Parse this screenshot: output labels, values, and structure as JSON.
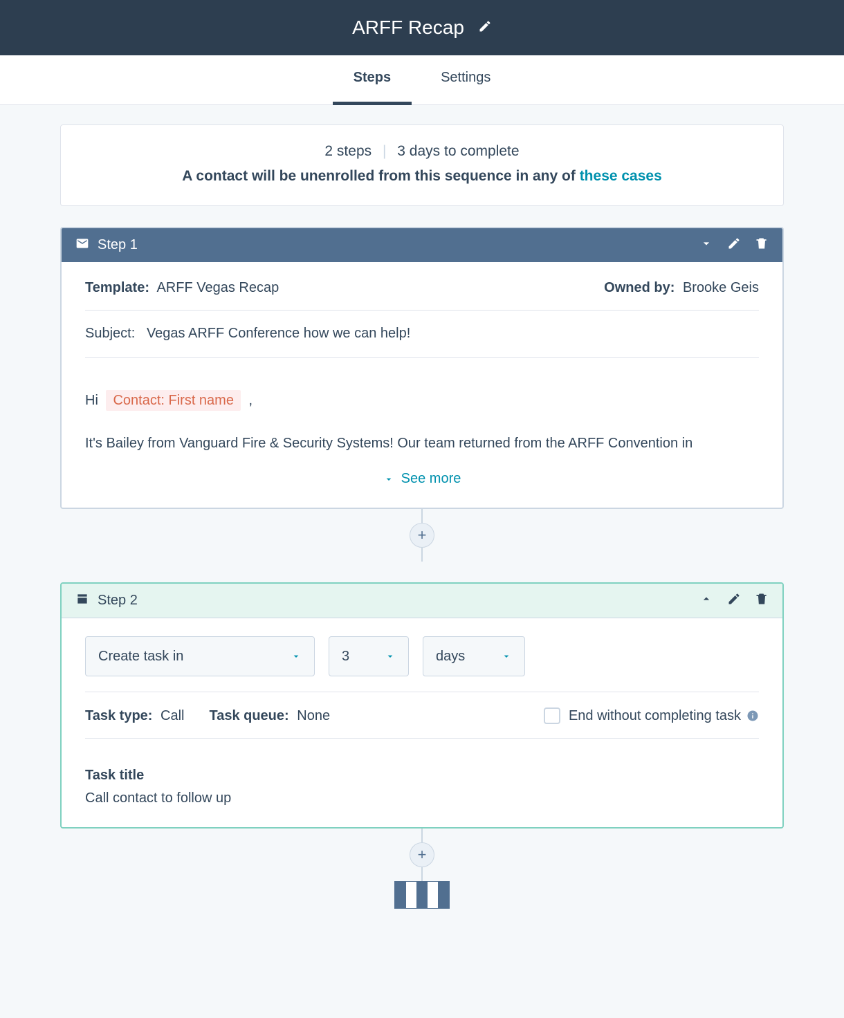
{
  "header": {
    "title": "ARFF Recap"
  },
  "tabs": {
    "steps": "Steps",
    "settings": "Settings"
  },
  "summary": {
    "steps_count": "2 steps",
    "days_to_complete": "3 days to complete",
    "unenroll_prefix": "A contact will be unenrolled from this sequence in any of ",
    "unenroll_link": "these cases"
  },
  "step1": {
    "title": "Step 1",
    "template_label": "Template:",
    "template_value": "ARFF Vegas Recap",
    "owned_by_label": "Owned by:",
    "owned_by_value": "Brooke Geis",
    "subject_label": "Subject:",
    "subject_value": "Vegas ARFF Conference how we can help!",
    "body_hi": "Hi",
    "body_token": "Contact: First name",
    "body_comma": ",",
    "body_para": "It's Bailey from Vanguard Fire & Security Systems! Our team returned from the ARFF Convention in",
    "see_more": "See more"
  },
  "step2": {
    "title": "Step 2",
    "create_task_in": "Create task in",
    "delay_number": "3",
    "delay_unit": "days",
    "task_type_label": "Task type:",
    "task_type_value": "Call",
    "task_queue_label": "Task queue:",
    "task_queue_value": "None",
    "end_without_label": "End without completing task",
    "task_title_label": "Task title",
    "task_title_value": "Call contact to follow up"
  }
}
